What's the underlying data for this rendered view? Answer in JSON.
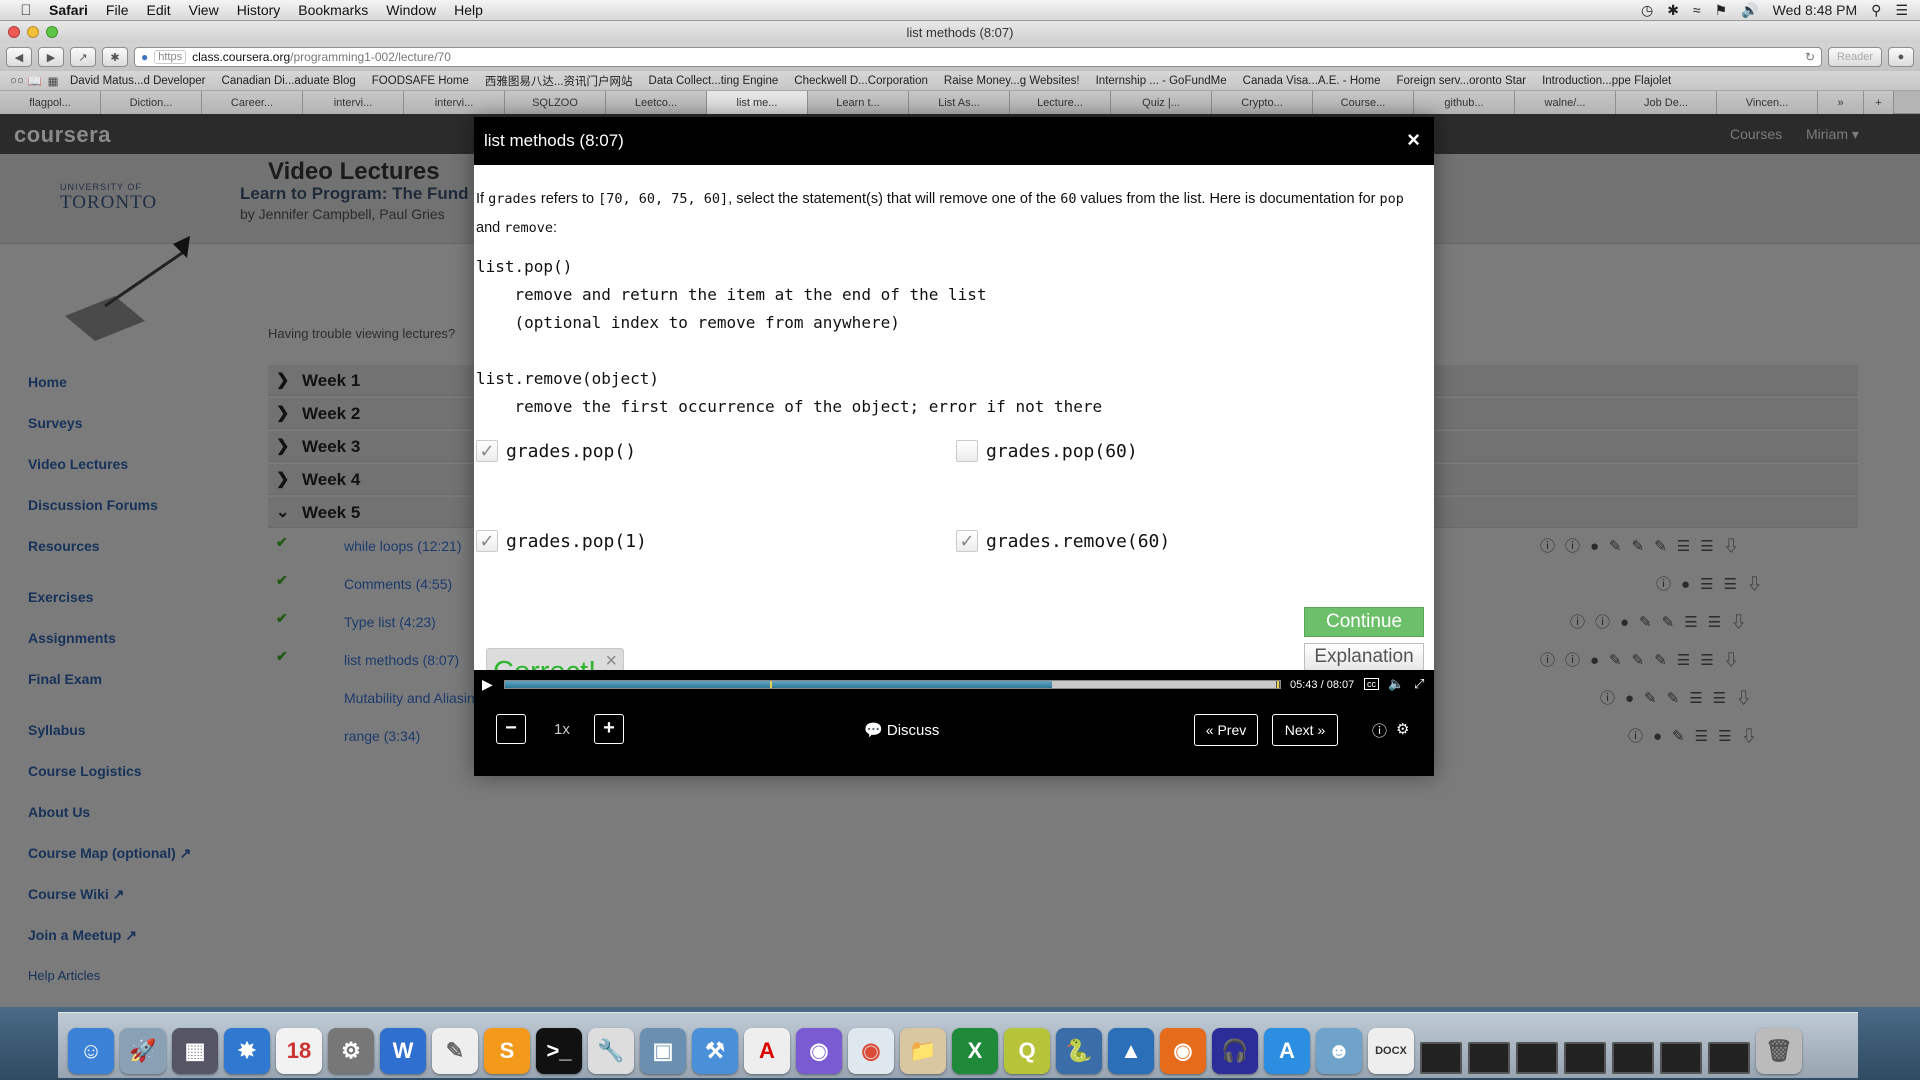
{
  "menubar": {
    "app": "Safari",
    "items": [
      "File",
      "Edit",
      "View",
      "History",
      "Bookmarks",
      "Window",
      "Help"
    ],
    "clock": "Wed 8:48 PM"
  },
  "window": {
    "title": "list methods (8:07)"
  },
  "toolbar": {
    "url_https": "https",
    "url_domain": "class.coursera.org",
    "url_path": "/programming1-002/lecture/70",
    "reader": "Reader"
  },
  "bookmarks": [
    "David Matus...d Developer",
    "Canadian Di...aduate Blog",
    "FOODSAFE Home",
    "西雅图易八达...资讯门户网站",
    "Data Collect...ting Engine",
    "Checkwell D...Corporation",
    "Raise Money...g Websites!",
    "Internship ... - GoFundMe",
    "Canada Visa...A.E. - Home",
    "Foreign serv...oronto Star",
    "Introduction...ppe Flajolet"
  ],
  "tabs": [
    "flagpol...",
    "Diction...",
    "Career...",
    "intervi...",
    "intervi...",
    "SQLZOO",
    "Leetco...",
    "list me...",
    "Learn t...",
    "List As...",
    "Lecture...",
    "Quiz |...",
    "Crypto...",
    "Course...",
    "github...",
    "walne/...",
    "Job De...",
    "Vincen..."
  ],
  "coursera": {
    "logo": "coursera",
    "nav_courses": "Courses",
    "nav_user": "Miriam ▾",
    "uoft_small": "UNIVERSITY OF",
    "uoft_big": "TORONTO",
    "course_title": "Learn to Program: The Fund",
    "authors": "by Jennifer Campbell, Paul Gries",
    "section_title": "Video Lectures",
    "section_sub": "Having trouble viewing lectures?",
    "sidebar": [
      "Home",
      "Surveys",
      "Video Lectures",
      "Discussion Forums",
      "Resources",
      "Exercises",
      "Assignments",
      "Final Exam",
      "Syllabus",
      "Course Logistics",
      "About Us",
      "Course Map (optional) ↗",
      "Course Wiki ↗",
      "Join a Meetup ↗",
      "Help Articles"
    ],
    "weeks": [
      "Week 1",
      "Week 2",
      "Week 3",
      "Week 4",
      "Week 5"
    ],
    "lectures": [
      {
        "title": "while loops (12:21)",
        "done": true
      },
      {
        "title": "Comments (4:55)",
        "done": true
      },
      {
        "title": "Type list (4:23)",
        "done": true
      },
      {
        "title": "list methods (8:07)",
        "done": true
      },
      {
        "title": "Mutability and Aliasin",
        "done": false
      },
      {
        "title": "range (3:34)",
        "done": false
      }
    ]
  },
  "modal": {
    "title": "list methods (8:07)",
    "close": "×",
    "question": {
      "p1": "If ",
      "var": "grades",
      "p2": " refers to ",
      "list": "[70, 60, 75, 60]",
      "p3": ", select the statement(s) that will remove one of the ",
      "val": "60",
      "p4": " values from the list. Here is documentation for ",
      "pop": "pop",
      "p5": " and ",
      "remove": "remove",
      "p6": ":"
    },
    "code": "list.pop()\n    remove and return the item at the end of the list\n    (optional index to remove from anywhere)\n\nlist.remove(object)\n    remove the first occurrence of the object; error if not there",
    "options": [
      {
        "label": "grades.pop()",
        "checked": true
      },
      {
        "label": "grades.pop(60)",
        "checked": false
      },
      {
        "label": "grades.pop(1)",
        "checked": true
      },
      {
        "label": "grades.remove(60)",
        "checked": true
      }
    ],
    "continue": "Continue",
    "explanation": "Explanation",
    "feedback": "Correct!",
    "feedback_close": "×"
  },
  "player": {
    "time": "05:43 / 08:07",
    "progress_fraction": 0.706,
    "buffered_fraction": 0.995,
    "cc": "cc",
    "minus": "−",
    "speed": "1x",
    "plus": "+",
    "discuss": "Discuss",
    "prev": "« Prev",
    "next": "Next »"
  },
  "colors": {
    "correct_green": "#2db52d",
    "continue_green": "#6cc06a",
    "progress_blue": "#2f7796"
  }
}
